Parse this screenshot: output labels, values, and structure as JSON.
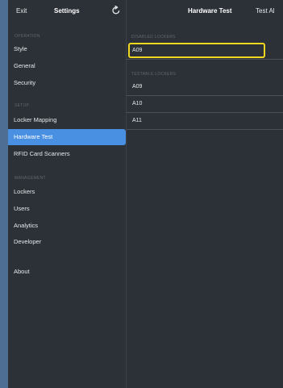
{
  "sidebar": {
    "exit_label": "Exit",
    "title": "Settings",
    "refresh_icon": "refresh-icon",
    "sections": {
      "operation": "OPERATION",
      "setup": "SETUP",
      "management": "MANAGEMENT"
    },
    "items": [
      {
        "label": "Style"
      },
      {
        "label": "General"
      },
      {
        "label": "Security"
      },
      {
        "label": "Locker Mapping"
      },
      {
        "label": "Hardware Test"
      },
      {
        "label": "RFID Card Scanners"
      },
      {
        "label": "Lockers"
      },
      {
        "label": "Users"
      },
      {
        "label": "Analytics"
      },
      {
        "label": "Developer"
      },
      {
        "label": "About"
      }
    ],
    "selected": "Hardware Test"
  },
  "main": {
    "title": "Hardware Test",
    "action_label": "Test Al",
    "disabled_label": "DISABLED LOCKERS",
    "disabled_lockers": [
      "A09"
    ],
    "testable_label": "TESTABLE LOCKERS",
    "testable_lockers": [
      "A09",
      "A10",
      "A11"
    ]
  },
  "colors": {
    "background": "#2b3136",
    "outer": "#4e6e94",
    "accent": "#4a90e2",
    "highlight": "#f0d820"
  }
}
